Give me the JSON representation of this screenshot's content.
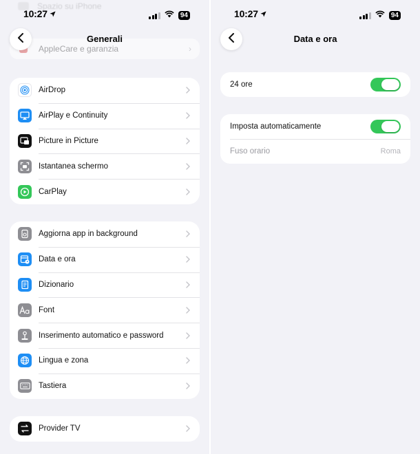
{
  "status_bar": {
    "time": "10:27",
    "battery": "94"
  },
  "left": {
    "nav_title": "Generali",
    "ghost_top_label": "Spazio su iPhone",
    "ghost_applecare_label": "AppleCare e garanzia",
    "groups": [
      {
        "items": [
          {
            "label": "AirDrop",
            "icon": "airdrop-icon",
            "color": "#ffffff"
          },
          {
            "label": "AirPlay e Continuity",
            "icon": "airplay-icon",
            "color": "#1e8ef4"
          },
          {
            "label": "Picture in Picture",
            "icon": "picture-in-picture-icon",
            "color": "#111111"
          },
          {
            "label": "Istantanea schermo",
            "icon": "screenshot-icon",
            "color": "#8e8e93"
          },
          {
            "label": "CarPlay",
            "icon": "carplay-icon",
            "color": "#34c759"
          }
        ]
      },
      {
        "items": [
          {
            "label": "Aggiorna app in background",
            "icon": "background-refresh-icon",
            "color": "#8e8e93"
          },
          {
            "label": "Data e ora",
            "icon": "calendar-clock-icon",
            "color": "#1e8ef4"
          },
          {
            "label": "Dizionario",
            "icon": "dictionary-icon",
            "color": "#1e8ef4"
          },
          {
            "label": "Font",
            "icon": "font-icon",
            "color": "#8e8e93"
          },
          {
            "label": "Inserimento automatico e password",
            "icon": "autofill-password-icon",
            "color": "#8e8e93"
          },
          {
            "label": "Lingua e zona",
            "icon": "globe-icon",
            "color": "#1e8ef4"
          },
          {
            "label": "Tastiera",
            "icon": "keyboard-icon",
            "color": "#8e8e93"
          }
        ]
      },
      {
        "items": [
          {
            "label": "Provider TV",
            "icon": "tv-provider-icon",
            "color": "#111111"
          }
        ]
      }
    ]
  },
  "right": {
    "nav_title": "Data e ora",
    "format_24h": {
      "label": "24 ore",
      "enabled": true
    },
    "auto_set": {
      "label": "Imposta automaticamente",
      "enabled": true
    },
    "timezone": {
      "label": "Fuso orario",
      "value": "Roma"
    }
  },
  "colors": {
    "toggle_on": "#34c759",
    "background": "#f2f2f7",
    "accent_blue": "#1e8ef4"
  }
}
